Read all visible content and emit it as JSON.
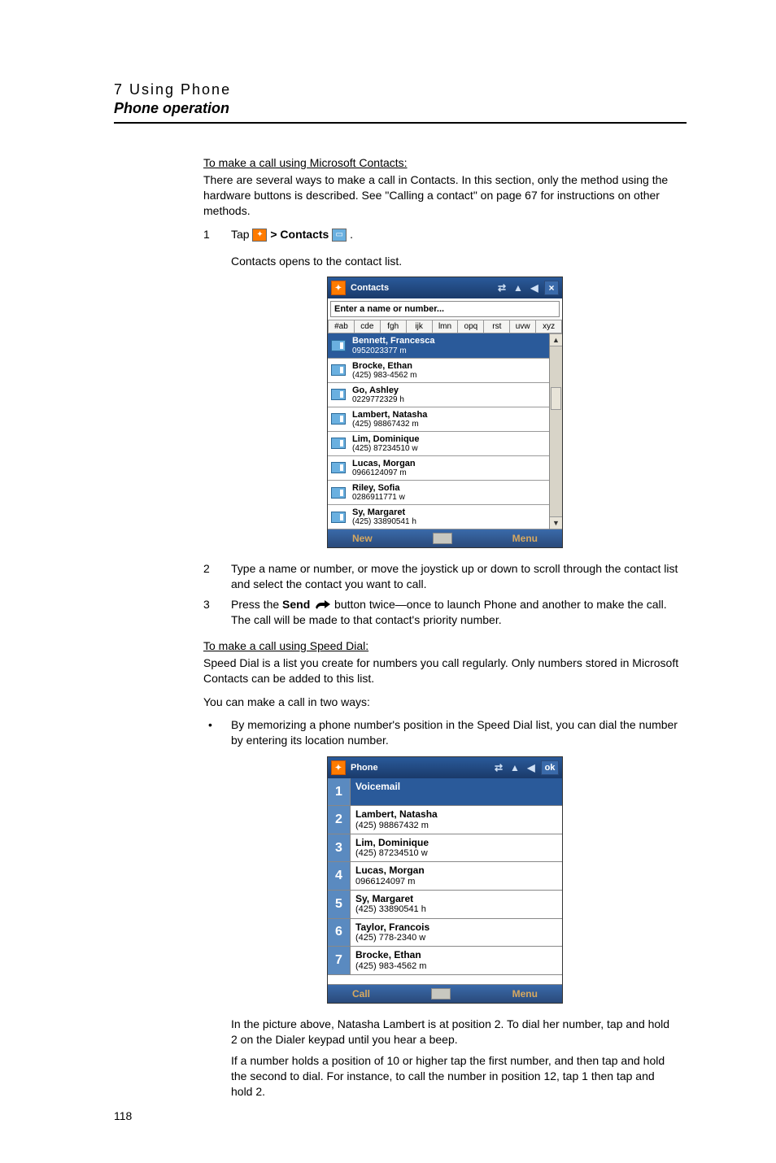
{
  "header": {
    "chapter": "7 Using Phone",
    "section": "Phone operation"
  },
  "section1": {
    "subhead": "To make a call using Microsoft Contacts:",
    "intro": "There are several ways to make a call in Contacts. In this section, only the method using the hardware buttons is described. See \"Calling a contact\" on page 67 for instructions on other methods.",
    "step1_num": "1",
    "step1_prefix": "Tap ",
    "step1_mid": " > Contacts ",
    "step1_suffix": ".",
    "step1_sub": "Contacts opens to the contact list.",
    "step2_num": "2",
    "step2_text": "Type a name or number, or move the joystick up or down to scroll through the contact list and select the contact you want to call.",
    "step3_num": "3",
    "step3_prefix": "Press the ",
    "step3_send": "Send",
    "step3_suffix": " button twice—once to launch Phone and another to make the call. The call will be made to that contact's priority number."
  },
  "contacts_shot": {
    "title": "Contacts",
    "search_placeholder": "Enter a name or number...",
    "alpha": [
      "#ab",
      "cde",
      "fgh",
      "ijk",
      "lmn",
      "opq",
      "rst",
      "uvw",
      "xyz"
    ],
    "rows": [
      {
        "name": "Bennett, Francesca",
        "num": "0952023377  m",
        "sel": true
      },
      {
        "name": "Brocke, Ethan",
        "num": "(425) 983-4562  m",
        "sel": false
      },
      {
        "name": "Go, Ashley",
        "num": "0229772329  h",
        "sel": false
      },
      {
        "name": "Lambert, Natasha",
        "num": "(425) 98867432  m",
        "sel": false
      },
      {
        "name": "Lim, Dominique",
        "num": "(425) 87234510  w",
        "sel": false
      },
      {
        "name": "Lucas, Morgan",
        "num": "0966124097  m",
        "sel": false
      },
      {
        "name": "Riley, Sofia",
        "num": "0286911771  w",
        "sel": false
      },
      {
        "name": "Sy, Margaret",
        "num": "(425) 33890541  h",
        "sel": false
      }
    ],
    "soft_left": "New",
    "soft_right": "Menu"
  },
  "section2": {
    "subhead": "To make a call using Speed Dial:",
    "intro": "Speed Dial is a list you create for numbers you call regularly. Only numbers stored in Microsoft Contacts can be added to this list.",
    "line2": "You can make a call in two ways:",
    "bullet1": "By memorizing a phone number's position in the Speed Dial list, you can dial the number by entering its location number."
  },
  "phone_shot": {
    "title": "Phone",
    "ok": "ok",
    "rows": [
      {
        "n": "1",
        "name": "Voicemail",
        "num": "",
        "sel": true
      },
      {
        "n": "2",
        "name": "Lambert, Natasha",
        "num": "(425) 98867432 m",
        "sel": false
      },
      {
        "n": "3",
        "name": "Lim, Dominique",
        "num": "(425) 87234510 w",
        "sel": false
      },
      {
        "n": "4",
        "name": "Lucas, Morgan",
        "num": "0966124097 m",
        "sel": false
      },
      {
        "n": "5",
        "name": "Sy, Margaret",
        "num": "(425) 33890541 h",
        "sel": false
      },
      {
        "n": "6",
        "name": "Taylor, Francois",
        "num": "(425) 778-2340 w",
        "sel": false
      },
      {
        "n": "7",
        "name": "Brocke, Ethan",
        "num": "(425) 983-4562 m",
        "sel": false
      }
    ],
    "soft_left": "Call",
    "soft_right": "Menu"
  },
  "after1": " In the picture above, Natasha Lambert is at position 2. To dial her number, tap and hold 2 on the Dialer keypad until you hear a beep.",
  "after2": " If a number holds a position of 10 or higher tap the first number, and then tap and hold the second to dial. For instance, to call the number in position 12, tap 1 then tap and hold 2.",
  "page_number": "118"
}
